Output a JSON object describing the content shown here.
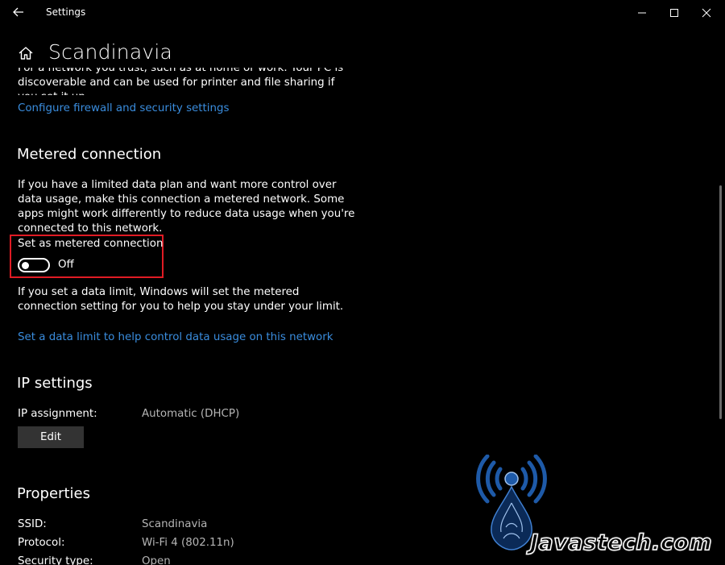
{
  "window": {
    "title": "Settings",
    "controls": [
      "minimize",
      "maximize",
      "close"
    ]
  },
  "page": {
    "title": "Scandinavia"
  },
  "network_profile": {
    "description_line1": "For a network you trust, such as at home or work. Your PC is",
    "description_line2": "discoverable and can be used for printer and file sharing if you set it up.",
    "firewall_link": "Configure firewall and security settings"
  },
  "metered": {
    "heading": "Metered connection",
    "description": "If you have a limited data plan and want more control over data usage, make this connection a metered network. Some apps might work differently to reduce data usage when you're connected to this network.",
    "toggle_label": "Set as metered connection",
    "toggle_state": "Off",
    "toggle_on": false,
    "data_limit_note": "If you set a data limit, Windows will set the metered connection setting for you to help you stay under your limit.",
    "data_limit_link": "Set a data limit to help control data usage on this network"
  },
  "ip_settings": {
    "heading": "IP settings",
    "assignment_label": "IP assignment:",
    "assignment_value": "Automatic (DHCP)",
    "edit_label": "Edit"
  },
  "properties": {
    "heading": "Properties",
    "rows": [
      {
        "key": "SSID:",
        "value": "Scandinavia"
      },
      {
        "key": "Protocol:",
        "value": "Wi-Fi 4 (802.11n)"
      },
      {
        "key": "Security type:",
        "value": "Open"
      }
    ]
  },
  "watermark": {
    "text": "Javastech.com",
    "icon": "wireless-signal-icon"
  },
  "colors": {
    "background": "#000000",
    "link": "#3a8dde",
    "highlight_box": "#e01b24",
    "watermark_blue": "#1e5aa8"
  }
}
